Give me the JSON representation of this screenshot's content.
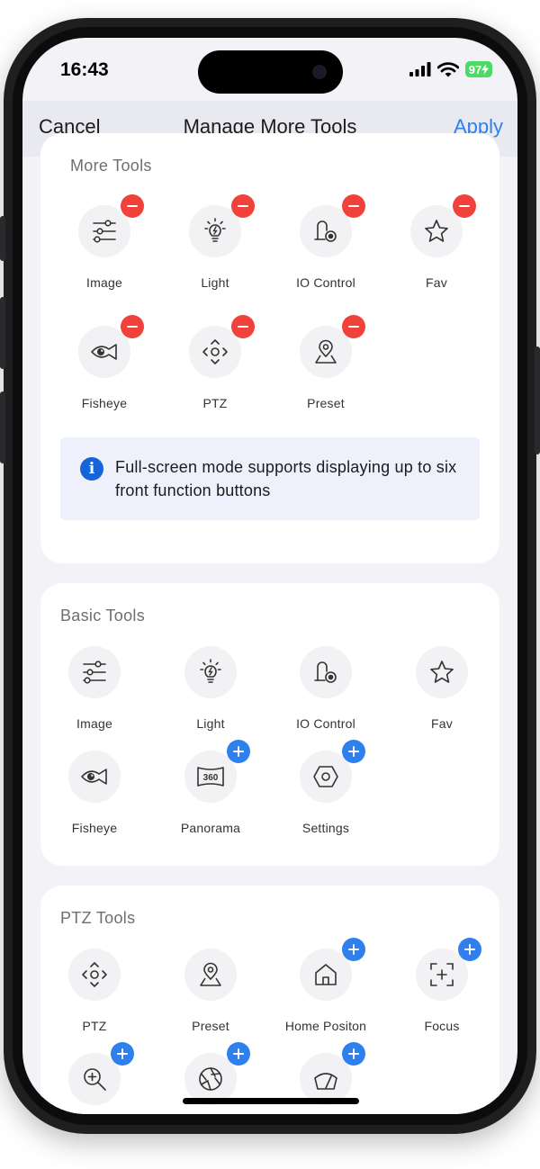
{
  "status_bar": {
    "time": "16:43",
    "battery": "97"
  },
  "nav": {
    "cancel": "Cancel",
    "title": "Manage More Tools",
    "apply": "Apply"
  },
  "more_tools": {
    "title": "More Tools",
    "items": [
      {
        "label": "Image",
        "icon": "sliders-icon",
        "badge": "remove"
      },
      {
        "label": "Light",
        "icon": "light-bulb-icon",
        "badge": "remove"
      },
      {
        "label": "IO Control",
        "icon": "io-control-icon",
        "badge": "remove"
      },
      {
        "label": "Fav",
        "icon": "star-icon",
        "badge": "remove"
      },
      {
        "label": "Fisheye",
        "icon": "fisheye-icon",
        "badge": "remove"
      },
      {
        "label": "PTZ",
        "icon": "ptz-icon",
        "badge": "remove"
      },
      {
        "label": "Preset",
        "icon": "preset-pin-icon",
        "badge": "remove"
      }
    ],
    "info": "Full-screen mode supports displaying up to six front function buttons"
  },
  "basic_tools": {
    "title": "Basic Tools",
    "items": [
      {
        "label": "Image",
        "icon": "sliders-icon",
        "badge": "none"
      },
      {
        "label": "Light",
        "icon": "light-bulb-icon",
        "badge": "none"
      },
      {
        "label": "IO Control",
        "icon": "io-control-icon",
        "badge": "none"
      },
      {
        "label": "Fav",
        "icon": "star-icon",
        "badge": "none"
      },
      {
        "label": "Fisheye",
        "icon": "fisheye-icon",
        "badge": "none"
      },
      {
        "label": "Panorama",
        "icon": "panorama-360-icon",
        "badge": "add"
      },
      {
        "label": "Settings",
        "icon": "hexagon-settings-icon",
        "badge": "add"
      }
    ]
  },
  "ptz_tools": {
    "title": "PTZ Tools",
    "items": [
      {
        "label": "PTZ",
        "icon": "ptz-icon",
        "badge": "none"
      },
      {
        "label": "Preset",
        "icon": "preset-pin-icon",
        "badge": "none"
      },
      {
        "label": "Home Positon",
        "icon": "home-icon",
        "badge": "add"
      },
      {
        "label": "Focus",
        "icon": "focus-icon",
        "badge": "add"
      },
      {
        "label": "",
        "icon": "zoom-icon",
        "badge": "add"
      },
      {
        "label": "",
        "icon": "aperture-icon",
        "badge": "add"
      },
      {
        "label": "",
        "icon": "wiper-icon",
        "badge": "add"
      }
    ]
  },
  "colors": {
    "accent": "#2f80ed",
    "remove_badge": "#f0413a",
    "add_badge": "#2f80ed",
    "info_icon": "#1565d8",
    "info_background": "#eef0fb",
    "battery": "#4cd964"
  }
}
